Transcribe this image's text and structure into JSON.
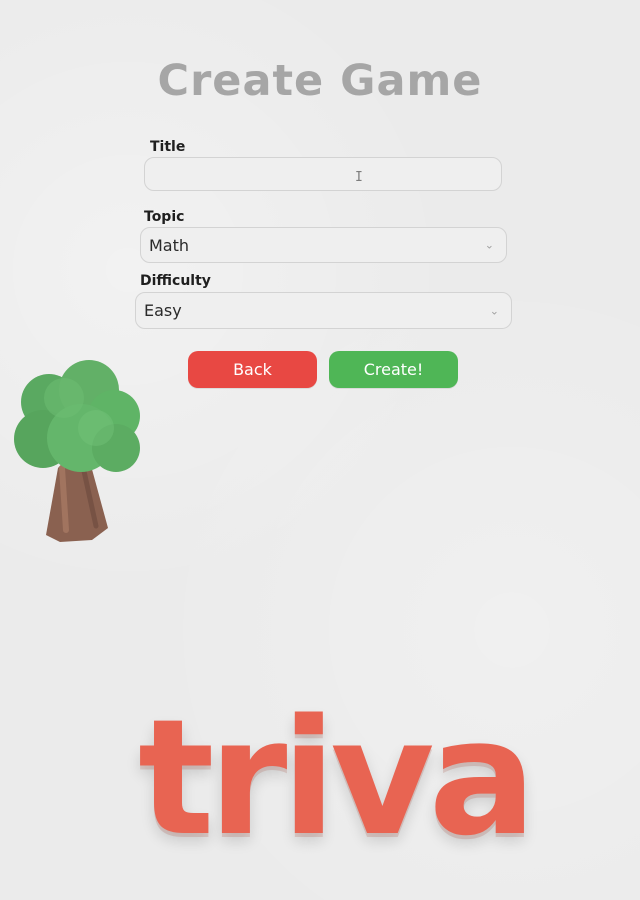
{
  "page": {
    "title": "Create Game"
  },
  "form": {
    "title_label": "Title",
    "title_value": "",
    "topic_label": "Topic",
    "topic_value": "Math",
    "difficulty_label": "Difficulty",
    "difficulty_value": "Easy"
  },
  "buttons": {
    "back_label": "Back",
    "create_label": "Create!"
  },
  "logo": {
    "wordmark": "triva",
    "tree_icon": "tree-icon"
  },
  "colors": {
    "back": "#e84843",
    "create": "#4fb656",
    "logo": "#e86452",
    "tree_green": "#5aa961",
    "tree_trunk": "#8a6150"
  }
}
